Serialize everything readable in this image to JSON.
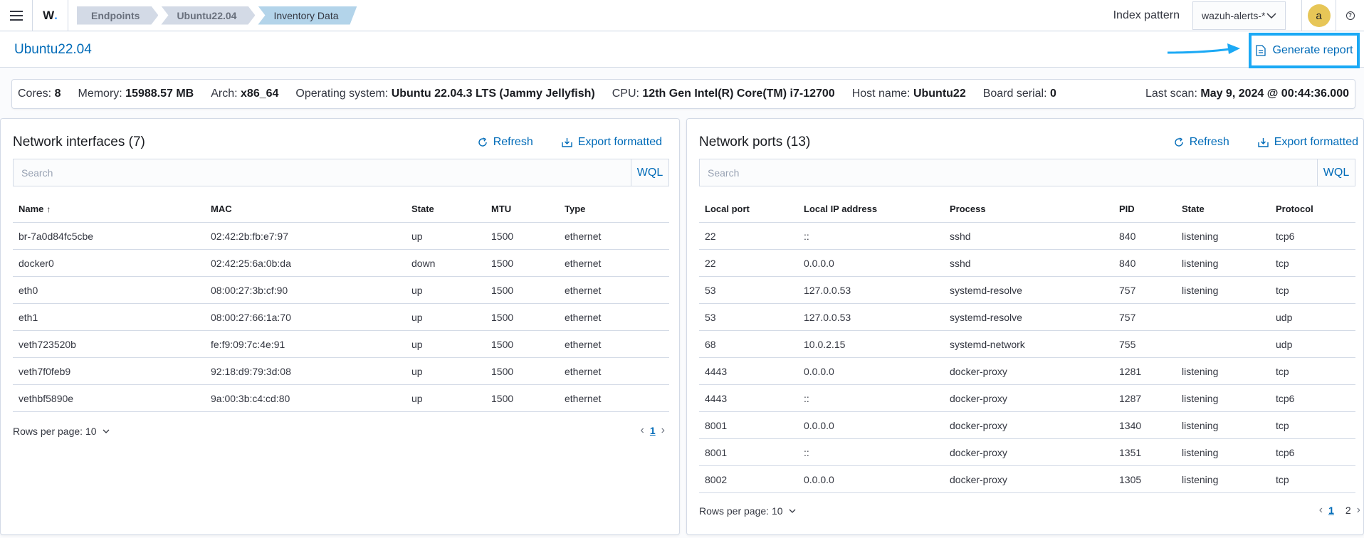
{
  "header": {
    "breadcrumbs": [
      "Endpoints",
      "Ubuntu22.04",
      "Inventory Data"
    ],
    "index_pattern_label": "Index pattern",
    "index_pattern_value": "wazuh-alerts-*",
    "avatar_initial": "a"
  },
  "agent_title": "Ubuntu22.04",
  "generate_report_label": "Generate report",
  "info": {
    "cores_label": "Cores:",
    "cores": "8",
    "memory_label": "Memory:",
    "memory": "15988.57 MB",
    "arch_label": "Arch:",
    "arch": "x86_64",
    "os_label": "Operating system:",
    "os": "Ubuntu 22.04.3 LTS (Jammy Jellyfish)",
    "cpu_label": "CPU:",
    "cpu": "12th Gen Intel(R) Core(TM) i7-12700",
    "host_label": "Host name:",
    "host": "Ubuntu22",
    "board_label": "Board serial:",
    "board": "0",
    "scan_label": "Last scan:",
    "scan": "May 9, 2024 @ 00:44:36.000"
  },
  "interfaces": {
    "title": "Network interfaces (7)",
    "refresh_label": "Refresh",
    "export_label": "Export formatted",
    "search_placeholder": "Search",
    "wql_label": "WQL",
    "columns": [
      "Name",
      "MAC",
      "State",
      "MTU",
      "Type"
    ],
    "rows": [
      [
        "br-7a0d84fc5cbe",
        "02:42:2b:fb:e7:97",
        "up",
        "1500",
        "ethernet"
      ],
      [
        "docker0",
        "02:42:25:6a:0b:da",
        "down",
        "1500",
        "ethernet"
      ],
      [
        "eth0",
        "08:00:27:3b:cf:90",
        "up",
        "1500",
        "ethernet"
      ],
      [
        "eth1",
        "08:00:27:66:1a:70",
        "up",
        "1500",
        "ethernet"
      ],
      [
        "veth723520b",
        "fe:f9:09:7c:4e:91",
        "up",
        "1500",
        "ethernet"
      ],
      [
        "veth7f0feb9",
        "92:18:d9:79:3d:08",
        "up",
        "1500",
        "ethernet"
      ],
      [
        "vethbf5890e",
        "9a:00:3b:c4:cd:80",
        "up",
        "1500",
        "ethernet"
      ]
    ],
    "rows_per_page": "Rows per page: 10",
    "pages": [
      "1"
    ]
  },
  "ports": {
    "title": "Network ports (13)",
    "refresh_label": "Refresh",
    "export_label": "Export formatted",
    "search_placeholder": "Search",
    "wql_label": "WQL",
    "columns": [
      "Local port",
      "Local IP address",
      "Process",
      "PID",
      "State",
      "Protocol"
    ],
    "rows": [
      [
        "22",
        "::",
        "sshd",
        "840",
        "listening",
        "tcp6"
      ],
      [
        "22",
        "0.0.0.0",
        "sshd",
        "840",
        "listening",
        "tcp"
      ],
      [
        "53",
        "127.0.0.53",
        "systemd-resolve",
        "757",
        "listening",
        "tcp"
      ],
      [
        "53",
        "127.0.0.53",
        "systemd-resolve",
        "757",
        "",
        "udp"
      ],
      [
        "68",
        "10.0.2.15",
        "systemd-network",
        "755",
        "",
        "udp"
      ],
      [
        "4443",
        "0.0.0.0",
        "docker-proxy",
        "1281",
        "listening",
        "tcp"
      ],
      [
        "4443",
        "::",
        "docker-proxy",
        "1287",
        "listening",
        "tcp6"
      ],
      [
        "8001",
        "0.0.0.0",
        "docker-proxy",
        "1340",
        "listening",
        "tcp"
      ],
      [
        "8001",
        "::",
        "docker-proxy",
        "1351",
        "listening",
        "tcp6"
      ],
      [
        "8002",
        "0.0.0.0",
        "docker-proxy",
        "1305",
        "listening",
        "tcp"
      ]
    ],
    "rows_per_page": "Rows per page: 10",
    "pages": [
      "1",
      "2"
    ]
  },
  "colors": {
    "link": "#006bb8",
    "highlight_border": "#1ba9f5",
    "avatar": "#e7c657"
  }
}
